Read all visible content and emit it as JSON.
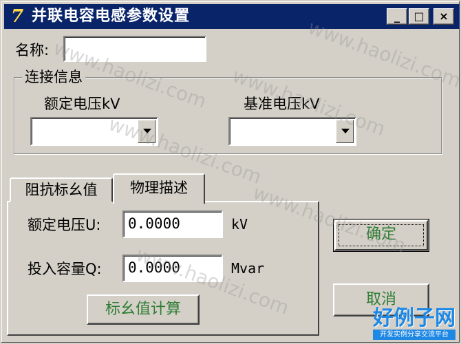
{
  "window": {
    "title": "并联电容电感参数设置",
    "icon": "app-logo-icon",
    "controls": {
      "minimize": "_",
      "maximize": "□",
      "close": "×"
    }
  },
  "name_field": {
    "label": "名称:",
    "value": ""
  },
  "connection_group": {
    "legend": "连接信息",
    "rated_voltage": {
      "label": "额定电压kV",
      "value": ""
    },
    "base_voltage": {
      "label": "基准电压kV",
      "value": ""
    }
  },
  "tabs": [
    {
      "label": "阻抗标幺值",
      "active": false
    },
    {
      "label": "物理描述",
      "active": true
    }
  ],
  "physical": {
    "rated_voltage": {
      "label": "额定电压U:",
      "value": "0.0000",
      "unit": "kV"
    },
    "capacity": {
      "label": "投入容量Q:",
      "value": "0.0000",
      "unit": "Mvar"
    },
    "calc_button": "标幺值计算"
  },
  "buttons": {
    "ok": "确定",
    "cancel": "取消"
  },
  "watermark": {
    "text": "www.haolizi.com",
    "logo_main": "好例子网",
    "logo_sub": "开发实例分享交流平台"
  },
  "colors": {
    "titlebar": "#0a246a",
    "button_text": "#2e7d32",
    "face": "#d4d0c8"
  }
}
